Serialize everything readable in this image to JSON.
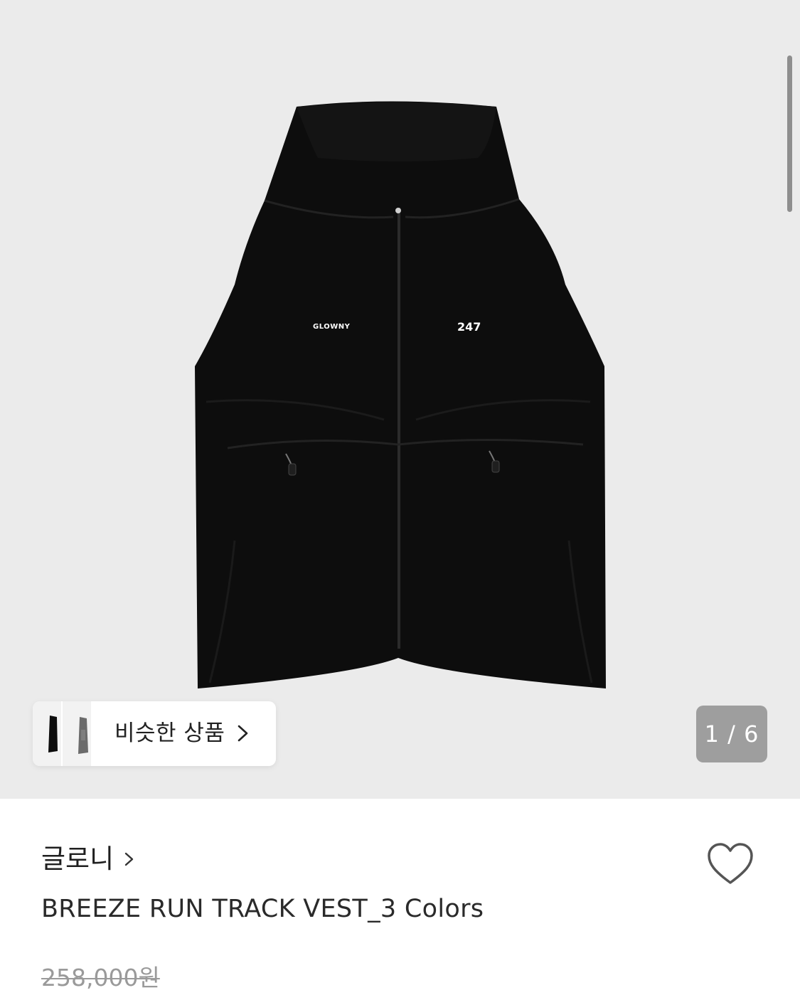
{
  "gallery": {
    "similar_products_label": "비슷한 상품",
    "image_counter": "1 / 6",
    "garment_print_left": "GLOWNY",
    "garment_print_right": "247"
  },
  "product": {
    "brand": "글로니",
    "name": "BREEZE RUN TRACK VEST_3 Colors",
    "original_price": "258,000원"
  },
  "icons": {
    "similar_chevron": "chevron-right-icon",
    "brand_chevron": "chevron-right-icon",
    "wishlist": "heart-outline-icon"
  },
  "colors": {
    "gallery_background": "#ebebeb",
    "vest": "#0d0d0d",
    "counter_badge": "#9e9e9e",
    "original_price": "#9a9a9a"
  }
}
